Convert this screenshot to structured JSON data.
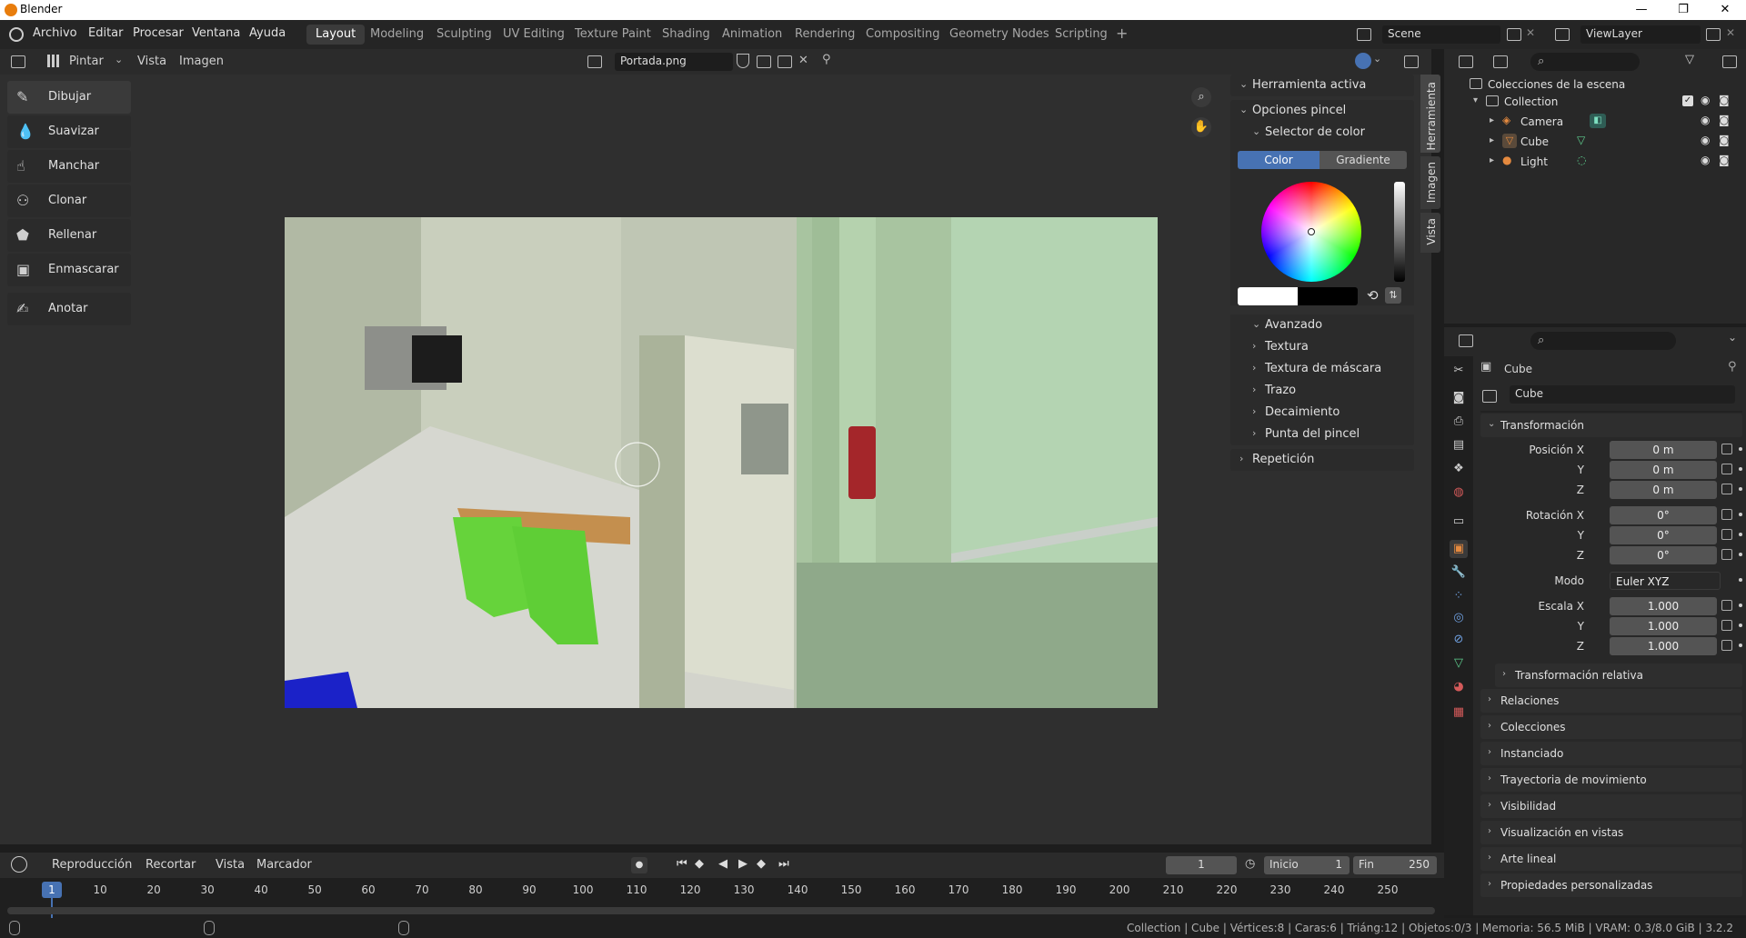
{
  "window": {
    "title": "Blender",
    "controls": [
      "—",
      "❐",
      "✕"
    ]
  },
  "menu": [
    "Archivo",
    "Editar",
    "Procesar",
    "Ventana",
    "Ayuda"
  ],
  "workspaces": [
    "Layout",
    "Modeling",
    "Sculpting",
    "UV Editing",
    "Texture Paint",
    "Shading",
    "Animation",
    "Rendering",
    "Compositing",
    "Geometry Nodes",
    "Scripting"
  ],
  "active_workspace": "Layout",
  "add_workspace": "+",
  "scene": {
    "name": "Scene",
    "view_layer": "ViewLayer"
  },
  "image_editor": {
    "mode": "Pintar",
    "menus": [
      "Vista",
      "Imagen"
    ],
    "image_name": "Portada.png"
  },
  "tools": [
    "Dibujar",
    "Suavizar",
    "Manchar",
    "Clonar",
    "Rellenar",
    "Enmascarar",
    "Anotar"
  ],
  "tool_icons": [
    "brush-icon",
    "smooth-icon",
    "smear-icon",
    "clone-icon",
    "fill-icon",
    "mask-icon",
    "annotate-icon"
  ],
  "npanel": {
    "herramienta_activa": "Herramienta activa",
    "opciones_pincel": "Opciones pincel",
    "selector_color": "Selector de color",
    "color_tab": "Color",
    "gradiente_tab": "Gradiente",
    "subpanels": [
      "Avanzado",
      "Textura",
      "Textura de máscara",
      "Trazo",
      "Decaimiento",
      "Punta del pincel"
    ],
    "repeticion": "Repetición",
    "tabs": [
      "Herramienta",
      "Imagen",
      "Vista"
    ],
    "accent": "#4772b3"
  },
  "outliner": {
    "root": "Colecciones de la escena",
    "collection": "Collection",
    "items": [
      "Camera",
      "Cube",
      "Light"
    ]
  },
  "properties": {
    "object_name": "Cube",
    "object_field": "Cube",
    "transform_title": "Transformación",
    "rows": [
      {
        "label": "Posición X",
        "value": "0 m"
      },
      {
        "label": "Y",
        "value": "0 m"
      },
      {
        "label": "Z",
        "value": "0 m"
      },
      {
        "label": "Rotación X",
        "value": "0°"
      },
      {
        "label": "Y",
        "value": "0°"
      },
      {
        "label": "Z",
        "value": "0°"
      }
    ],
    "mode_label": "Modo",
    "mode_value": "Euler XYZ",
    "scale_rows": [
      {
        "label": "Escala X",
        "value": "1.000"
      },
      {
        "label": "Y",
        "value": "1.000"
      },
      {
        "label": "Z",
        "value": "1.000"
      }
    ],
    "delta": "Transformación relativa",
    "sections": [
      "Relaciones",
      "Colecciones",
      "Instanciado",
      "Trayectoria de movimiento",
      "Visibilidad",
      "Visualización en vistas",
      "Arte lineal",
      "Propiedades personalizadas"
    ]
  },
  "timeline": {
    "menus": [
      "Reproducción",
      "Recortar",
      "Vista",
      "Marcador"
    ],
    "current_frame": "1",
    "start_label": "Inicio",
    "start": "1",
    "end_label": "Fin",
    "end": "250",
    "ticks": [
      "1",
      "10",
      "20",
      "30",
      "40",
      "50",
      "60",
      "70",
      "80",
      "90",
      "100",
      "110",
      "120",
      "130",
      "140",
      "150",
      "160",
      "170",
      "180",
      "190",
      "200",
      "210",
      "220",
      "230",
      "240",
      "250"
    ]
  },
  "status": "Collection | Cube | Vértices:8 | Caras:6 | Triáng:12 | Objetos:0/3 | Memoria: 56.5 MiB | VRAM: 0.3/8.0 GiB | 3.2.2"
}
